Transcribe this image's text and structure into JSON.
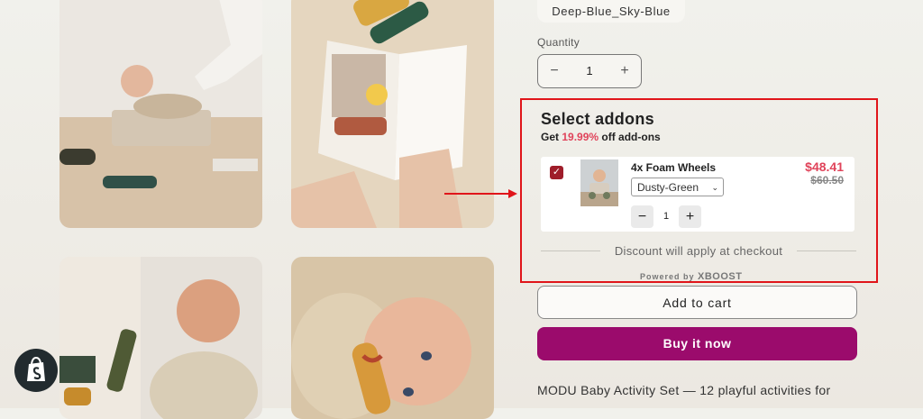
{
  "variant": {
    "selected": "Deep-Blue_Sky-Blue"
  },
  "quantity": {
    "label": "Quantity",
    "value": "1",
    "minus": "−",
    "plus": "+"
  },
  "addons": {
    "title": "Select addons",
    "subtitle_prefix": "Get ",
    "subtitle_pct": "19.99%",
    "subtitle_suffix": " off add-ons",
    "items": [
      {
        "name": "4x Foam Wheels",
        "price": "$48.41",
        "compare_price": "$60.50",
        "variant": "Dusty-Green",
        "qty": "1",
        "checked": true
      }
    ],
    "discount_note": "Discount will apply at checkout",
    "powered_by": "Powered by",
    "powered_brand": "XBOOST"
  },
  "buttons": {
    "add_to_cart": "Add to cart",
    "buy_now": "Buy it now"
  },
  "description": "MODU Baby Activity Set — 12 playful activities for",
  "colors": {
    "buy_now": "#9b0b6c",
    "price": "#e0435a",
    "highlight_border": "#e0151a"
  },
  "icons": {
    "checkbox": "check-icon",
    "badge": "shopify-bag-icon",
    "arrow": "red-arrow-icon"
  }
}
